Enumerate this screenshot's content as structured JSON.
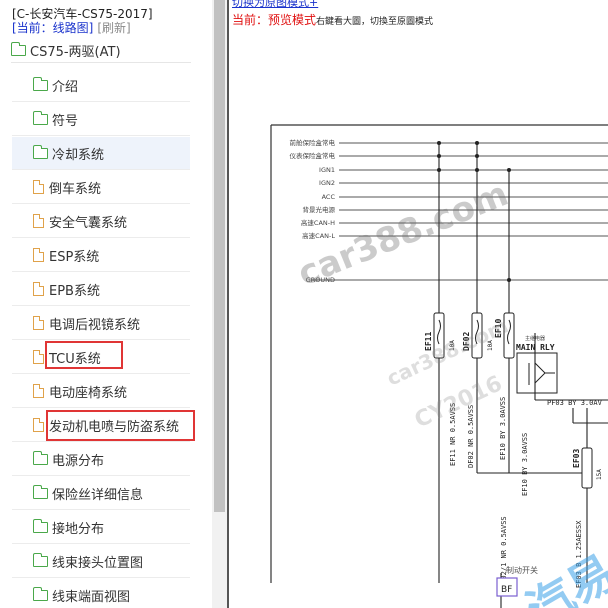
{
  "sidebar": {
    "breadcrumb_title": "[C-长安汽车-CS75-2017]",
    "breadcrumb_current_label": "[当前：线路图]",
    "breadcrumb_refresh": "[刷新]",
    "root_label": "CS75-两驱(AT)",
    "items": [
      {
        "label": "介绍",
        "icon": "folder-icon"
      },
      {
        "label": "符号",
        "icon": "folder-icon"
      },
      {
        "label": "冷却系统",
        "icon": "folder-icon",
        "selected": true
      },
      {
        "label": "倒车系统",
        "icon": "file-icon"
      },
      {
        "label": "安全气囊系统",
        "icon": "file-icon"
      },
      {
        "label": "ESP系统",
        "icon": "file-icon"
      },
      {
        "label": "EPB系统",
        "icon": "file-icon"
      },
      {
        "label": "电调后视镜系统",
        "icon": "file-icon"
      },
      {
        "label": "TCU系统",
        "icon": "file-icon",
        "highlighted": true
      },
      {
        "label": "电动座椅系统",
        "icon": "file-icon"
      },
      {
        "label": "发动机电喷与防盗系统",
        "icon": "file-icon",
        "highlighted": true
      },
      {
        "label": "电源分布",
        "icon": "folder-icon"
      },
      {
        "label": "保险丝详细信息",
        "icon": "folder-icon"
      },
      {
        "label": "接地分布",
        "icon": "folder-icon"
      },
      {
        "label": "线束接头位置图",
        "icon": "folder-icon"
      },
      {
        "label": "线束端面视图",
        "icon": "folder-icon"
      }
    ]
  },
  "content": {
    "toggle_link": "切换为原图模式+",
    "status_label": "当前：",
    "status_mode": "预览模式",
    "status_hint": "右鍵看大圖，切換至原圖模式"
  },
  "diagram": {
    "rails": [
      "前舱保险盒常电",
      "仪表保险盒常电",
      "IGN1",
      "IGN2",
      "ACC",
      "背景光电源",
      "高速CAN-H",
      "高速CAN-L",
      "GROUND"
    ],
    "fuses": [
      {
        "id": "EF11",
        "rating": "10A"
      },
      {
        "id": "DF02",
        "rating": "10A"
      },
      {
        "id": "EF10",
        "rating": "10A"
      },
      {
        "id": "EF03",
        "rating": "15A"
      }
    ],
    "relay_label": "MAIN RLY",
    "relay_sublabel": "主继电器",
    "wire_labels": [
      "EF11 NR 0.5AVSS",
      "DF02 NR 0.5AVSS",
      "EF10 BY 3.0AVSS",
      "EF10 BY 3.0AVSS",
      "DF02/1 NR 0.5AVSS",
      "EF03 B 1.25AESSX",
      "PF03 BY 3.0AV"
    ],
    "bottom_label": "制动开关",
    "bottom_box": "BF",
    "watermarks": [
      "car388.com",
      "car388.com",
      "CY2016",
      "汽易"
    ],
    "colors": {
      "wire": "#222222",
      "line": "#555555",
      "accent": "#1a33cc",
      "alert": "#e03535"
    }
  }
}
